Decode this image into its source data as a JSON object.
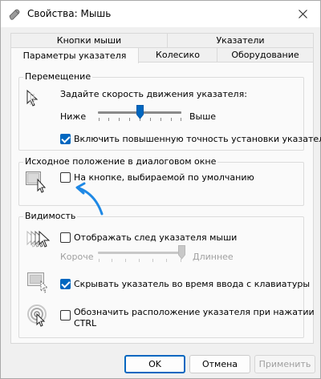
{
  "window": {
    "title": "Свойства: Мышь"
  },
  "tabs": {
    "row_top": [
      "Кнопки мыши",
      "Указатели"
    ],
    "row_bottom": [
      "Параметры указателя",
      "Колесико",
      "Оборудование"
    ],
    "active": "Параметры указателя"
  },
  "motion": {
    "legend": "Перемещение",
    "speed_label": "Задайте скорость движения указателя:",
    "slow_label": "Ниже",
    "fast_label": "Выше",
    "speed_value_fraction": 0.5,
    "precision_checkbox": {
      "label": "Включить повышенную точность установки указателя",
      "checked": true
    }
  },
  "snap_to": {
    "legend": "Исходное положение в диалоговом окне",
    "default_button_checkbox": {
      "label": "На кнопке, выбираемой по умолчанию",
      "checked": false
    }
  },
  "visibility": {
    "legend": "Видимость",
    "trails_checkbox": {
      "label": "Отображать след указателя мыши",
      "checked": false
    },
    "trails_short_label": "Короче",
    "trails_long_label": "Длиннее",
    "trails_value_fraction": 1.0,
    "hide_while_typing_checkbox": {
      "label": "Скрывать указатель во время ввода с клавиатуры",
      "checked": true
    },
    "show_location_checkbox": {
      "label_line1": "Обозначить расположение указателя при нажатии",
      "label_line2": "CTRL",
      "checked": false
    }
  },
  "buttons": {
    "ok": "OK",
    "cancel": "Отмена",
    "apply": "Применить"
  },
  "colors": {
    "accent": "#0067c0",
    "annotation_arrow": "#1e88e5"
  }
}
